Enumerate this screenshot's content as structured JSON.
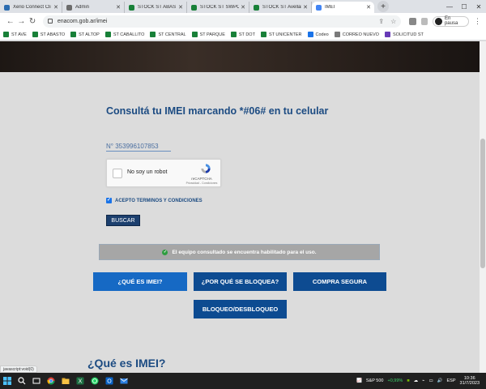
{
  "browser": {
    "tabs": [
      {
        "title": "Xerio Connect Cli",
        "color": "#2b6cb0",
        "active": false
      },
      {
        "title": "Admin",
        "color": "#6c6c6c",
        "active": false
      },
      {
        "title": "STOCK ST ABASTO",
        "color": "#188038",
        "active": false
      },
      {
        "title": "STOCK ST SWPOC",
        "color": "#188038",
        "active": false
      },
      {
        "title": "STOCK ST Avellane",
        "color": "#188038",
        "active": false
      },
      {
        "title": "IMEI",
        "color": "#4285f4",
        "active": true
      }
    ],
    "url": "enacom.gob.ar/imei",
    "profile_label": "En pausa",
    "bookmarks": [
      {
        "label": "ST AVE",
        "color": "#188038"
      },
      {
        "label": "ST ABASTO",
        "color": "#188038"
      },
      {
        "label": "ST ALTOP",
        "color": "#188038"
      },
      {
        "label": "ST CABALLITO",
        "color": "#188038"
      },
      {
        "label": "ST CENTRAL",
        "color": "#188038"
      },
      {
        "label": "ST PARQUE",
        "color": "#188038"
      },
      {
        "label": "ST DOT",
        "color": "#188038"
      },
      {
        "label": "ST UNICENTER",
        "color": "#188038"
      },
      {
        "label": "Codeo",
        "color": "#1a73e8"
      },
      {
        "label": "CORREO NUEVO",
        "color": "#7a7a7a"
      },
      {
        "label": "SOLICITUD ST",
        "color": "#673ab7"
      }
    ]
  },
  "page": {
    "heading": "Consultá tu IMEI marcando *#06# en tu celular",
    "imei_label": "N°",
    "imei_value": "353996107853",
    "captcha": {
      "label": "No soy un robot",
      "brand": "reCAPTCHA",
      "links": "Privacidad - Condiciones"
    },
    "terms_label": "ACEPTO TERMINOS Y CONDICIONES",
    "terms_checked": true,
    "search_button": "BUSCAR",
    "result_message": "El equipo consultado se encuentra habilitado para el uso.",
    "buttons": {
      "what_is_imei": "¿QUÉ ES IMEI?",
      "why_blocked": "¿POR QUÉ SE BLOQUEA?",
      "safe_purchase": "COMPRA SEGURA",
      "block_unblock": "BLOQUEO/DESBLOQUEO"
    },
    "section_heading": "¿Qué es IMEI?"
  },
  "status_text": "javascript:void(0)",
  "taskbar": {
    "stock_name": "S&P 500",
    "stock_change": "+0,99%",
    "language": "ESP",
    "time": "10:36",
    "date": "31/7/2023"
  },
  "colors": {
    "brand_blue": "#1c4b82",
    "button_blue": "#0d4b91",
    "success_green": "#2e9d3f"
  }
}
